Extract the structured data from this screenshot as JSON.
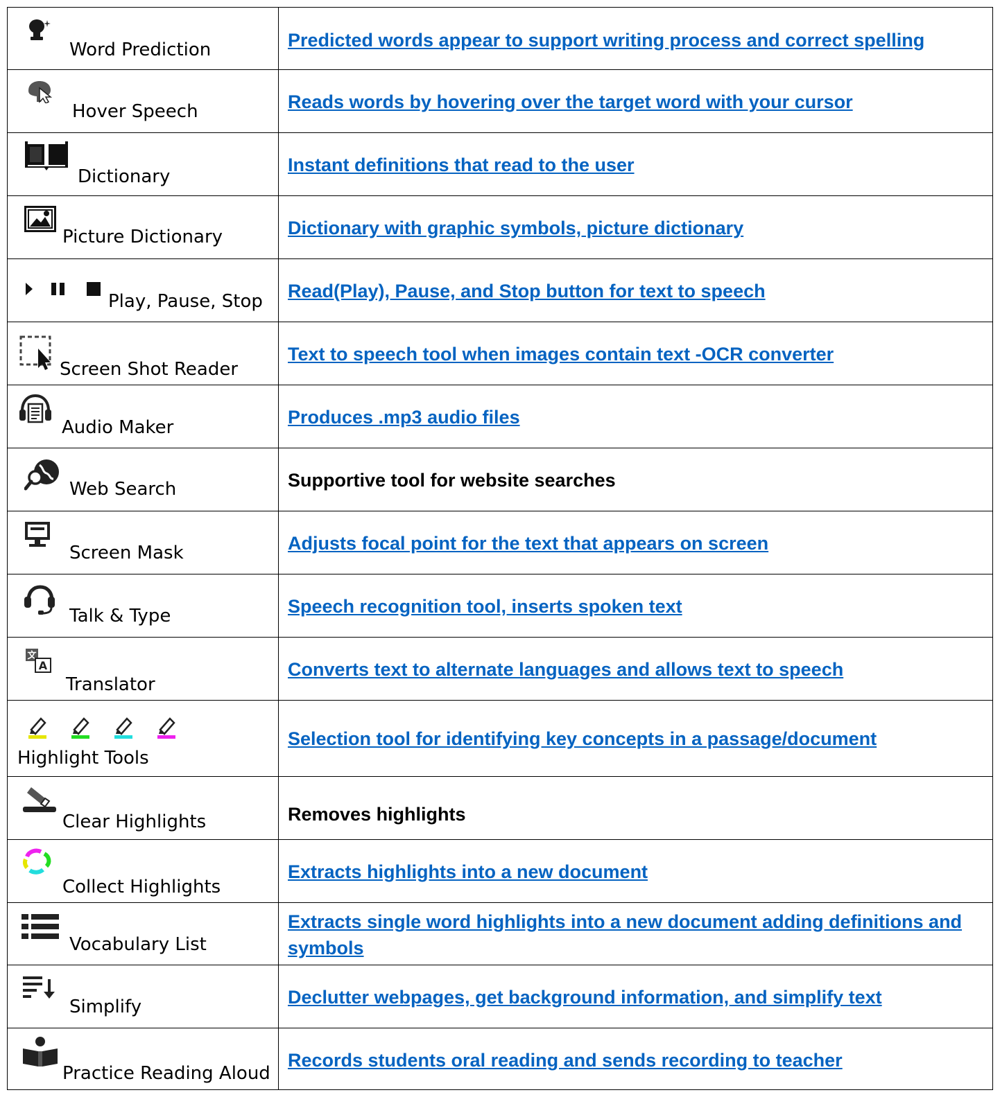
{
  "rows": [
    {
      "name": "Word Prediction",
      "icon": "word-prediction-icon",
      "desc": "Predicted words appear to support writing process and correct spelling",
      "link": true
    },
    {
      "name": "Hover Speech",
      "icon": "hover-speech-icon",
      "desc": "Reads words by hovering over the target word with your cursor",
      "link": true
    },
    {
      "name": "Dictionary",
      "icon": "book-icon",
      "desc": "Instant definitions that read to the user",
      "link": true
    },
    {
      "name": "Picture Dictionary",
      "icon": "picture-icon",
      "desc": "Dictionary with graphic symbols, picture dictionary",
      "link": true
    },
    {
      "name": "Play, Pause, Stop",
      "icon": "play-pause-stop-icons",
      "desc": "Read(Play), Pause, and Stop button for text to speech",
      "link": true
    },
    {
      "name": "Screen Shot Reader",
      "icon": "screenshot-reader-icon",
      "desc": "Text to speech tool when images contain text -OCR converter",
      "link": true
    },
    {
      "name": "Audio Maker",
      "icon": "headphones-document-icon",
      "desc": "Produces .mp3 audio files",
      "link": true
    },
    {
      "name": "Web Search",
      "icon": "globe-search-icon",
      "desc": "Supportive tool for website searches",
      "link": false
    },
    {
      "name": "Screen Mask",
      "icon": "monitor-icon",
      "desc": "Adjusts focal point for the text that appears on screen",
      "link": true
    },
    {
      "name": "Talk & Type",
      "icon": "headset-icon",
      "desc": "Speech recognition tool, inserts spoken text",
      "link": true
    },
    {
      "name": "Translator",
      "icon": "translate-icon",
      "desc": "Converts text to alternate languages and allows text to speech",
      "link": true
    },
    {
      "name": "Highlight Tools",
      "icon": "highlighter-icons",
      "desc": "Selection tool for identifying key concepts in a passage/document",
      "link": true
    },
    {
      "name": "Clear Highlights",
      "icon": "eraser-icon",
      "desc": "Removes highlights",
      "link": false
    },
    {
      "name": "Collect Highlights",
      "icon": "collect-cycle-icon",
      "desc": "Extracts highlights into a new document",
      "link": true
    },
    {
      "name": "Vocabulary List",
      "icon": "list-icon",
      "desc": "Extracts single word highlights into a new document adding definitions and symbols",
      "link": true
    },
    {
      "name": "Simplify",
      "icon": "simplify-icon",
      "desc": "Declutter webpages, get background information, and simplify text",
      "link": true
    },
    {
      "name": "Practice Reading Aloud",
      "icon": "reader-person-icon",
      "desc": "Records students oral reading and sends recording to teacher",
      "link": true
    }
  ],
  "highlighter_colors": [
    "#e6e600",
    "#22dd22",
    "#22dddd",
    "#ee22ee"
  ]
}
